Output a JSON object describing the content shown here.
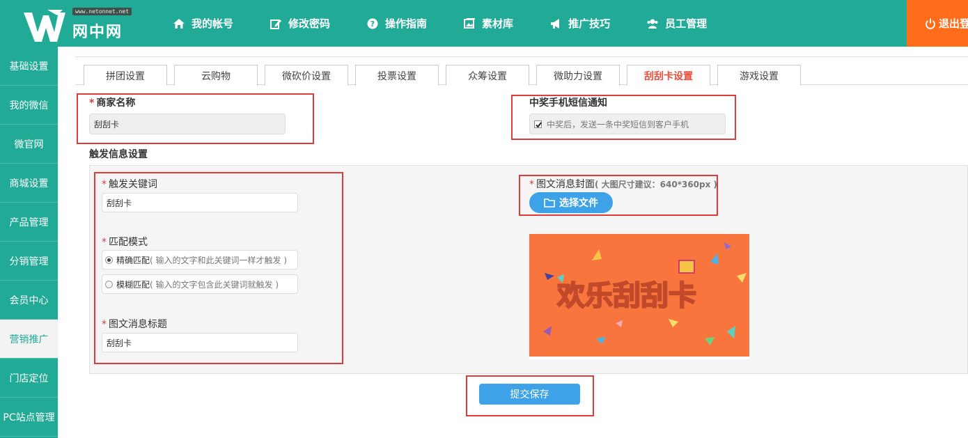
{
  "header": {
    "logo_url": "www.netonnet.net",
    "logo_text": "网中网",
    "nav": [
      {
        "label": "我的帐号",
        "icon": "home-icon"
      },
      {
        "label": "修改密码",
        "icon": "edit-icon"
      },
      {
        "label": "操作指南",
        "icon": "help-icon"
      },
      {
        "label": "素材库",
        "icon": "gallery-icon"
      },
      {
        "label": "推广技巧",
        "icon": "megaphone-icon"
      },
      {
        "label": "员工管理",
        "icon": "users-icon"
      }
    ],
    "logout_label": "退出登"
  },
  "sidebar": {
    "items": [
      {
        "label": "基础设置"
      },
      {
        "label": "我的微信"
      },
      {
        "label": "微官网"
      },
      {
        "label": "商城设置"
      },
      {
        "label": "产品管理"
      },
      {
        "label": "分销管理"
      },
      {
        "label": "会员中心"
      },
      {
        "label": "营销推广"
      },
      {
        "label": "门店定位"
      },
      {
        "label": "PC站点管理"
      }
    ],
    "active_index": 7
  },
  "tabs": {
    "items": [
      "拼团设置",
      "云购物",
      "微砍价设置",
      "投票设置",
      "众筹设置",
      "微助力设置",
      "刮刮卡设置",
      "游戏设置"
    ],
    "active_index": 6
  },
  "form": {
    "merchant_name_label": "商家名称",
    "merchant_name_value": "刮刮卡",
    "sms_label": "中奖手机短信通知",
    "sms_checkbox_text": "中奖后，发送一条中奖短信到客户手机",
    "sms_checked": true,
    "trigger_section_title": "触发信息设置",
    "keyword_label": "触发关键词",
    "keyword_value": "刮刮卡",
    "match_label": "匹配模式",
    "match_exact_label": "精确匹配",
    "match_exact_hint": "( 输入的文字和此关键词一样才触发 )",
    "match_fuzzy_label": "模糊匹配",
    "match_fuzzy_hint": "( 输入的文字包含此关键词就触发 )",
    "match_selected": "exact",
    "title_label": "图文消息标题",
    "title_value": "刮刮卡",
    "cover_label": "图文消息封面",
    "cover_hint": "( 大图尺寸建议：640*360px )",
    "file_button_label": "选择文件",
    "cover_image_text": "欢乐刮刮卡",
    "submit_label": "提交保存"
  },
  "colors": {
    "primary": "#21ab97",
    "logout": "#ff6c1a",
    "button": "#3ea2e9",
    "highlight": "#e03a3a",
    "cover_bg": "#f8763e"
  }
}
